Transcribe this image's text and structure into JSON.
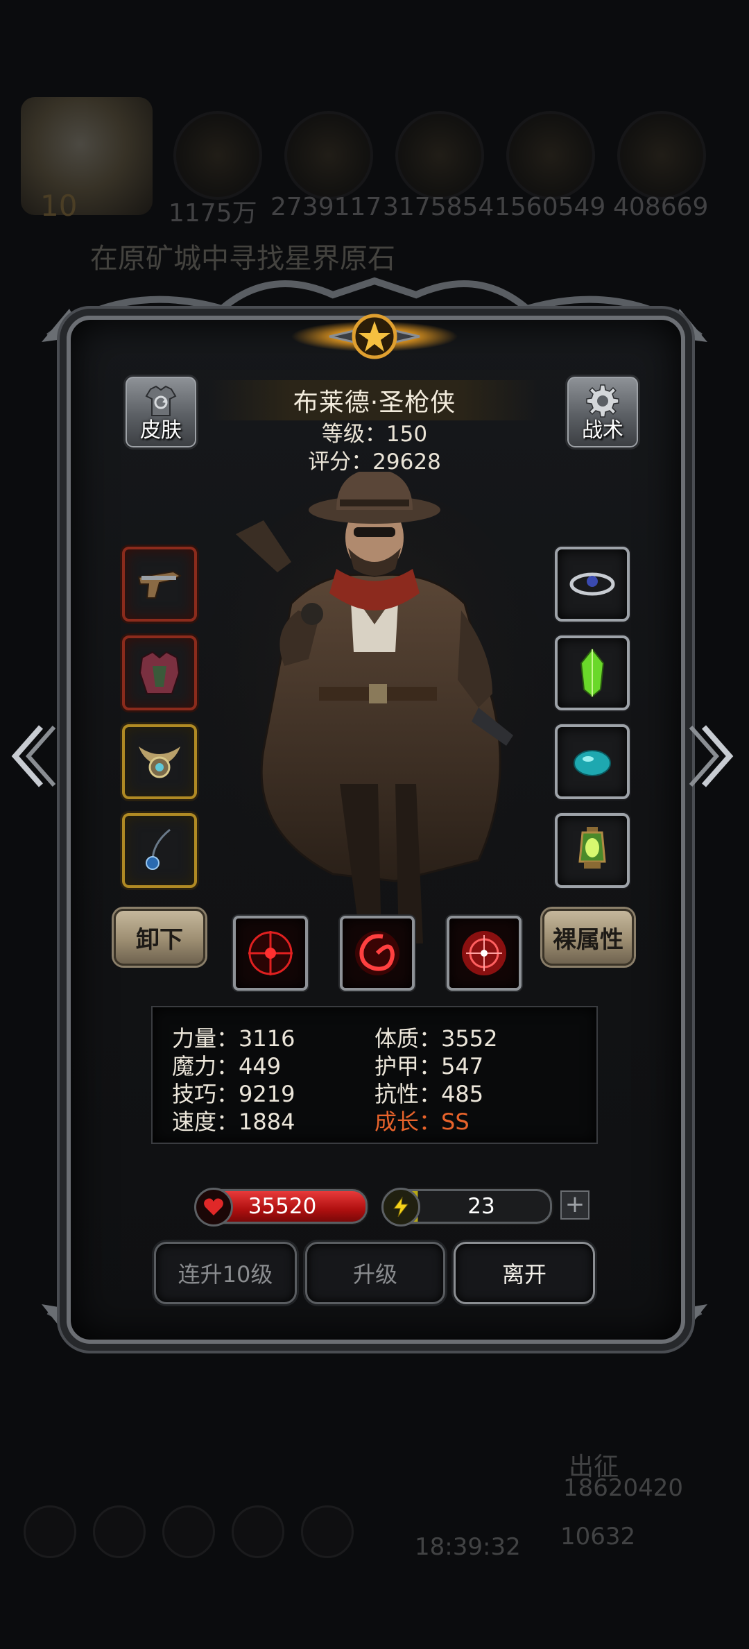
{
  "background": {
    "resources": [
      "1175万",
      "2739117",
      "3175854",
      "1560549",
      "408669"
    ],
    "avatar_level": "10",
    "quest_text": "在原矿城中寻找星界原石",
    "bottom_label": "出征",
    "bottom_value": "18620420",
    "bottom_value2": "10632",
    "clock": "18:39:32"
  },
  "hero": {
    "name": "布莱德·圣枪侠",
    "level": "等级：150",
    "score": "评分：29628"
  },
  "buttons": {
    "skin": "皮肤",
    "tactics": "战术",
    "unequip": "卸下",
    "base_attributes": "裸属性",
    "level_up_10": "连升10级",
    "level_up": "升级",
    "leave": "离开"
  },
  "icons": {
    "skin": "shirt-swap-icon",
    "tactics": "gear-icon",
    "left_arrow": "double-chevron-left-icon",
    "right_arrow": "double-chevron-right-icon",
    "hp": "heart-icon",
    "energy": "lightning-icon",
    "plus": "plus-icon"
  },
  "equipment_left": [
    "pistol-icon",
    "armor-icon",
    "amulet-icon",
    "pendant-icon"
  ],
  "equipment_right": [
    "ring-icon",
    "crystal-icon",
    "gem-icon",
    "lantern-icon"
  ],
  "skills": [
    "crosshair-skill-icon",
    "vortex-skill-icon",
    "target-skill-icon"
  ],
  "stats": {
    "strength": "力量：3116",
    "magic": "魔力：449",
    "skill": "技巧：9219",
    "speed": "速度：1884",
    "constitution": "体质：3552",
    "armor": "护甲：547",
    "resistance": "抗性：485",
    "growth": "成长：SS"
  },
  "bars": {
    "hp": "35520",
    "energy": "23",
    "energy_fill_fraction": 0.2
  },
  "colors": {
    "growth": "#e8632b",
    "hp": "#c21414",
    "energy": "#d6c61a"
  }
}
